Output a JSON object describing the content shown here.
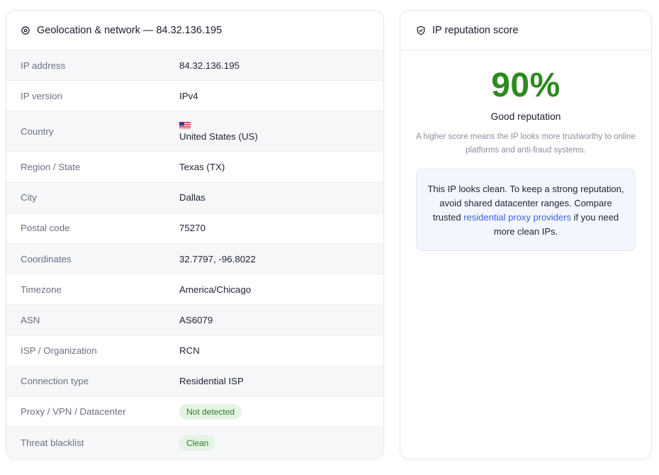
{
  "geo": {
    "title": "Geolocation & network — 84.32.136.195",
    "rows": [
      {
        "label": "IP address",
        "value": "84.32.136.195"
      },
      {
        "label": "IP version",
        "value": "IPv4"
      },
      {
        "label": "Country",
        "value": "United States (US)"
      },
      {
        "label": "Region / State",
        "value": "Texas (TX)"
      },
      {
        "label": "City",
        "value": "Dallas"
      },
      {
        "label": "Postal code",
        "value": "75270"
      },
      {
        "label": "Coordinates",
        "value": "32.7797, -96.8022"
      },
      {
        "label": "Timezone",
        "value": "America/Chicago"
      },
      {
        "label": "ASN",
        "value": "AS6079"
      },
      {
        "label": "ISP / Organization",
        "value": "RCN"
      },
      {
        "label": "Connection type",
        "value": "Residential ISP"
      },
      {
        "label": "Proxy / VPN / Datacenter",
        "value": "Not detected"
      },
      {
        "label": "Threat blacklist",
        "value": "Clean"
      }
    ]
  },
  "reputation": {
    "title": "IP reputation score",
    "score": "90%",
    "status": "Good reputation",
    "description": "A higher score means the IP looks more trustworthy to online platforms and anti-fraud systems.",
    "advice_before": "This IP looks clean. To keep a strong reputation, avoid shared datacenter ranges. Compare trusted ",
    "advice_link": "residential proxy providers",
    "advice_after": " if you need more clean IPs."
  },
  "colors": {
    "score": "#2e8a1f",
    "badge_bg": "#e4f4e4",
    "badge_text": "#2f7a28",
    "link": "#3d63d9"
  },
  "icons": {
    "geo": "location-pin-icon",
    "reputation": "shield-check-icon",
    "country_flag": "us-flag-icon"
  }
}
